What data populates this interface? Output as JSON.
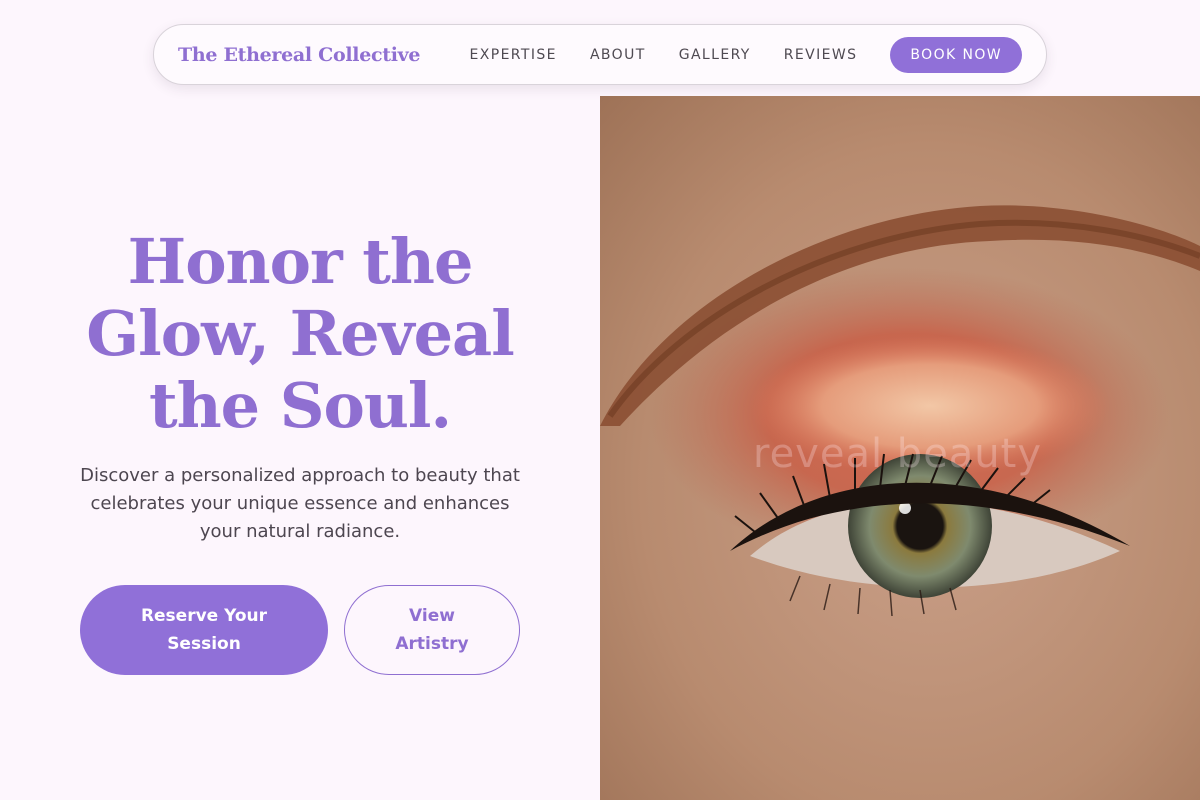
{
  "nav": {
    "brand": "The Ethereal Collective",
    "links": [
      "EXPERTISE",
      "ABOUT",
      "GALLERY",
      "REVIEWS"
    ],
    "cta": "BOOK NOW"
  },
  "hero": {
    "title": "Honor the Glow, Reveal the Soul.",
    "subtitle": "Discover a personalized approach to beauty that celebrates your unique essence and enhances your natural radiance.",
    "primary_button": "Reserve Your Session",
    "secondary_button": "View Artistry",
    "image_watermark": "reveal beauty"
  },
  "colors": {
    "accent": "#9070d8",
    "background": "#fdf6fd",
    "text": "#4d4650"
  }
}
